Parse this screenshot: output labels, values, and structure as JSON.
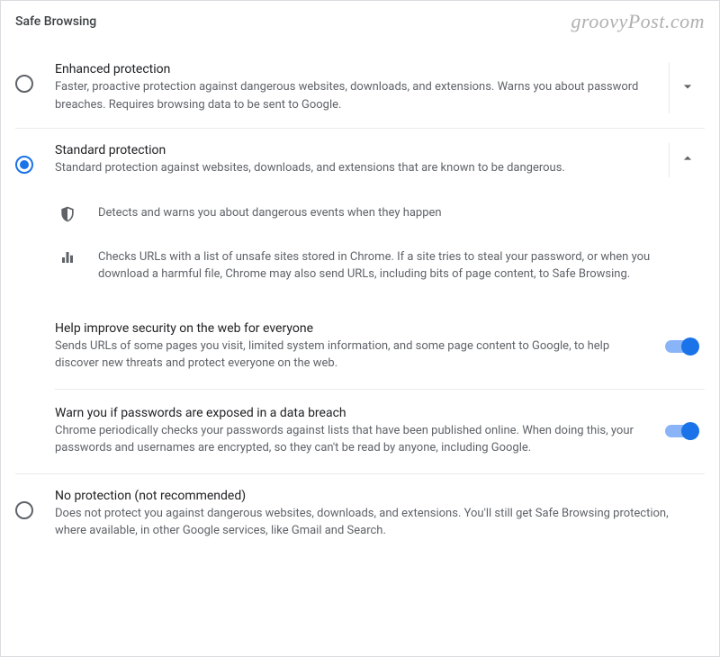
{
  "section_title": "Safe Browsing",
  "watermark": "groovyPost.com",
  "options": {
    "enhanced": {
      "title": "Enhanced protection",
      "desc": "Faster, proactive protection against dangerous websites, downloads, and extensions. Warns you about password breaches. Requires browsing data to be sent to Google."
    },
    "standard": {
      "title": "Standard protection",
      "desc": "Standard protection against websites, downloads, and extensions that are known to be dangerous.",
      "details": {
        "d0": "Detects and warns you about dangerous events when they happen",
        "d1": "Checks URLs with a list of unsafe sites stored in Chrome. If a site tries to steal your password, or when you download a harmful file, Chrome may also send URLs, including bits of page content, to Safe Browsing."
      },
      "subs": {
        "help": {
          "title": "Help improve security on the web for everyone",
          "desc": "Sends URLs of some pages you visit, limited system information, and some page content to Google, to help discover new threats and protect everyone on the web."
        },
        "warn": {
          "title": "Warn you if passwords are exposed in a data breach",
          "desc": "Chrome periodically checks your passwords against lists that have been published online. When doing this, your passwords and usernames are encrypted, so they can't be read by anyone, including Google."
        }
      }
    },
    "none": {
      "title": "No protection (not recommended)",
      "desc": "Does not protect you against dangerous websites, downloads, and extensions. You'll still get Safe Browsing protection, where available, in other Google services, like Gmail and Search."
    }
  }
}
